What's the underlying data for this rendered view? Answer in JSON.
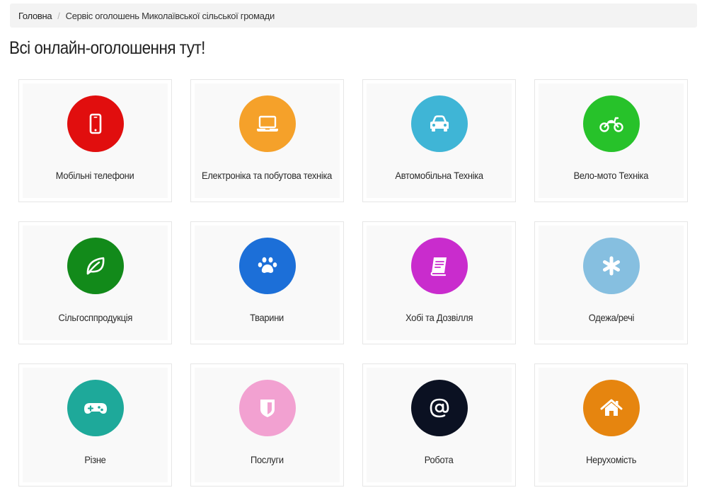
{
  "breadcrumb": {
    "home": "Головна",
    "separator": "/",
    "current": "Сервіс оголошень Миколаївської сільської громади"
  },
  "title": "Всі онлайн-оголошення тут!",
  "categories": [
    {
      "label": "Мобільні телефони",
      "icon": "mobile-phone-icon",
      "color": "#e10e0e"
    },
    {
      "label": "Електроніка та побутова техніка",
      "icon": "laptop-icon",
      "color": "#f5a12a"
    },
    {
      "label": "Автомобільна Техніка",
      "icon": "car-icon",
      "color": "#3fb5d6"
    },
    {
      "label": "Вело-мото Техніка",
      "icon": "motorcycle-icon",
      "color": "#27c22a"
    },
    {
      "label": "Сільгосппродукція",
      "icon": "leaf-icon",
      "color": "#128a1a"
    },
    {
      "label": "Тварини",
      "icon": "paw-icon",
      "color": "#1c6fd8"
    },
    {
      "label": "Хобі та Дозвілля",
      "icon": "book-icon",
      "color": "#c92ccd"
    },
    {
      "label": "Одежа/речі",
      "icon": "asterisk-icon",
      "color": "#86bfe0"
    },
    {
      "label": "Різне",
      "icon": "gamepad-icon",
      "color": "#1ea99a"
    },
    {
      "label": "Послуги",
      "icon": "shield-icon",
      "color": "#f2a1d1"
    },
    {
      "label": "Робота",
      "icon": "at-sign-icon",
      "color": "#0b1122"
    },
    {
      "label": "Нерухомість",
      "icon": "house-icon",
      "color": "#e6850f"
    }
  ]
}
